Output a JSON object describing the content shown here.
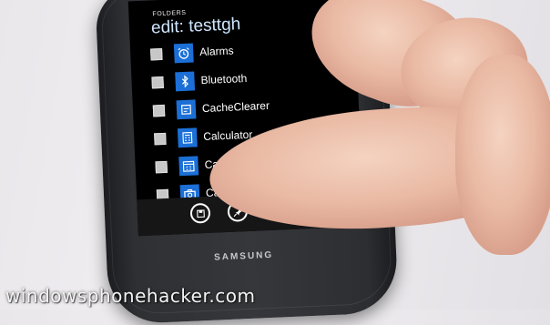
{
  "screen": {
    "section_label": "FOLDERS",
    "title": "edit: testtgh"
  },
  "apps": [
    {
      "label": "Alarms",
      "icon": "alarm-clock-icon"
    },
    {
      "label": "Bluetooth",
      "icon": "bluetooth-icon"
    },
    {
      "label": "CacheClearer",
      "icon": "app-icon"
    },
    {
      "label": "Calculator",
      "icon": "calculator-icon"
    },
    {
      "label": "Cal",
      "icon": "calendar-icon"
    },
    {
      "label": "Camera",
      "icon": "camera-icon"
    }
  ],
  "appbar": {
    "more_label": "..."
  },
  "device": {
    "brand": "SAMSUNG"
  },
  "watermark": "windowsphonehacker.com",
  "colors": {
    "accent": "#1b6fd6",
    "title": "#cfe6ff",
    "screen_bg": "#000000",
    "skin": "#e9b9a3"
  }
}
